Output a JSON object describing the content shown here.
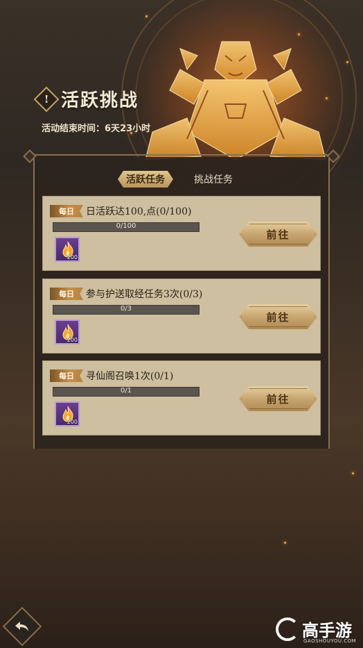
{
  "header": {
    "alert_symbol": "!",
    "title": "活跃挑战",
    "end_time": "活动结束时间：6天23小时"
  },
  "tabs": {
    "active": "活跃任务",
    "other": "挑战任务"
  },
  "tasks": [
    {
      "badge": "每日",
      "name": "日活跃达100,点(0/100)",
      "progress_text": "0/100",
      "progress": 0,
      "reward_qty": "200",
      "button": "前往"
    },
    {
      "badge": "每日",
      "name": "参与护送取经任务3次(0/3)",
      "progress_text": "0/3",
      "progress": 0,
      "reward_qty": "200",
      "button": "前往"
    },
    {
      "badge": "每日",
      "name": "寻仙阁召唤1次(0/1)",
      "progress_text": "0/1",
      "progress": 0,
      "reward_qty": "200",
      "button": "前往"
    }
  ],
  "watermark": {
    "text": "高手游",
    "sub": "GAOSHOUYOU.COM"
  },
  "colors": {
    "accent_gold": "#c89d3b",
    "card_bg": "#cdbf9f",
    "panel_border": "#8a6f4d"
  },
  "icons": {
    "alert": "alert-diamond-icon",
    "reward": "flame-icon",
    "back": "back-arrow-icon"
  }
}
